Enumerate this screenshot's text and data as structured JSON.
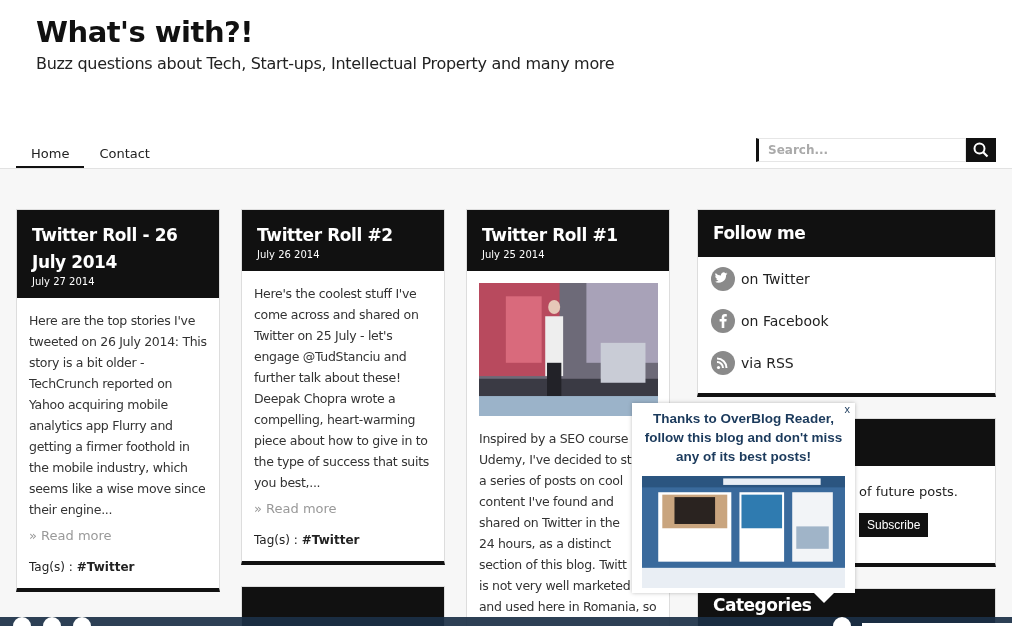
{
  "site": {
    "title": "What's with?!",
    "tagline": "Buzz questions about Tech, Start-ups, Intellectual Property and many more"
  },
  "nav": [
    {
      "label": "Home",
      "selected": true
    },
    {
      "label": "Contact",
      "selected": false
    }
  ],
  "search": {
    "placeholder": "Search..."
  },
  "columns": [
    [
      {
        "title": "Twitter Roll - 26 July 2014",
        "date": "July 27 2014",
        "excerpt": "Here are the top stories I've tweeted on 26 July 2014: This story is a bit older - TechCrunch reported on Yahoo acquiring mobile analytics app Flurry and getting a firmer foothold in the mobile industry, which seems like a wise move since their engine...",
        "read_more": "» Read more",
        "tags_label": "Tag(s) :",
        "tag": "#Twitter"
      }
    ],
    [
      {
        "title": "Twitter Roll #2",
        "date": "July 26 2014",
        "excerpt": "Here's the coolest stuff I've come across and shared on Twitter on 25 July - let's engage @TudStanciu and further talk about these! Deepak Chopra wrote a compelling, heart-warming piece about how to give in to the type of success that suits you best,...",
        "read_more": "» Read more",
        "tags_label": "Tag(s) :",
        "tag": "#Twitter"
      },
      {
        "kind": "teaser"
      }
    ],
    [
      {
        "title": "Twitter Roll #1",
        "date": "July 25 2014",
        "excerpt_lines": [
          "Inspired by a SEO course",
          "Udemy, I've decided to st",
          "a series of posts on cool",
          "content I've found and",
          "shared on Twitter in the",
          "24 hours, as a distinct",
          "section of this blog. Twitt",
          "is not very well marketed",
          "and used here in Romania, so"
        ]
      }
    ]
  ],
  "sidebar": [
    {
      "kind": "links",
      "title": "Follow me",
      "links": [
        {
          "label": "on Twitter"
        },
        {
          "label": "on Facebook"
        },
        {
          "label": "via RSS"
        }
      ]
    },
    {
      "kind": "subscribe",
      "text": "of future posts.",
      "button": "Subscribe"
    },
    {
      "kind": "heading",
      "title": "Categories"
    }
  ],
  "popup": {
    "message": "Thanks to OverBlog Reader, follow this blog and don't miss any of its best posts!",
    "close": "x"
  }
}
